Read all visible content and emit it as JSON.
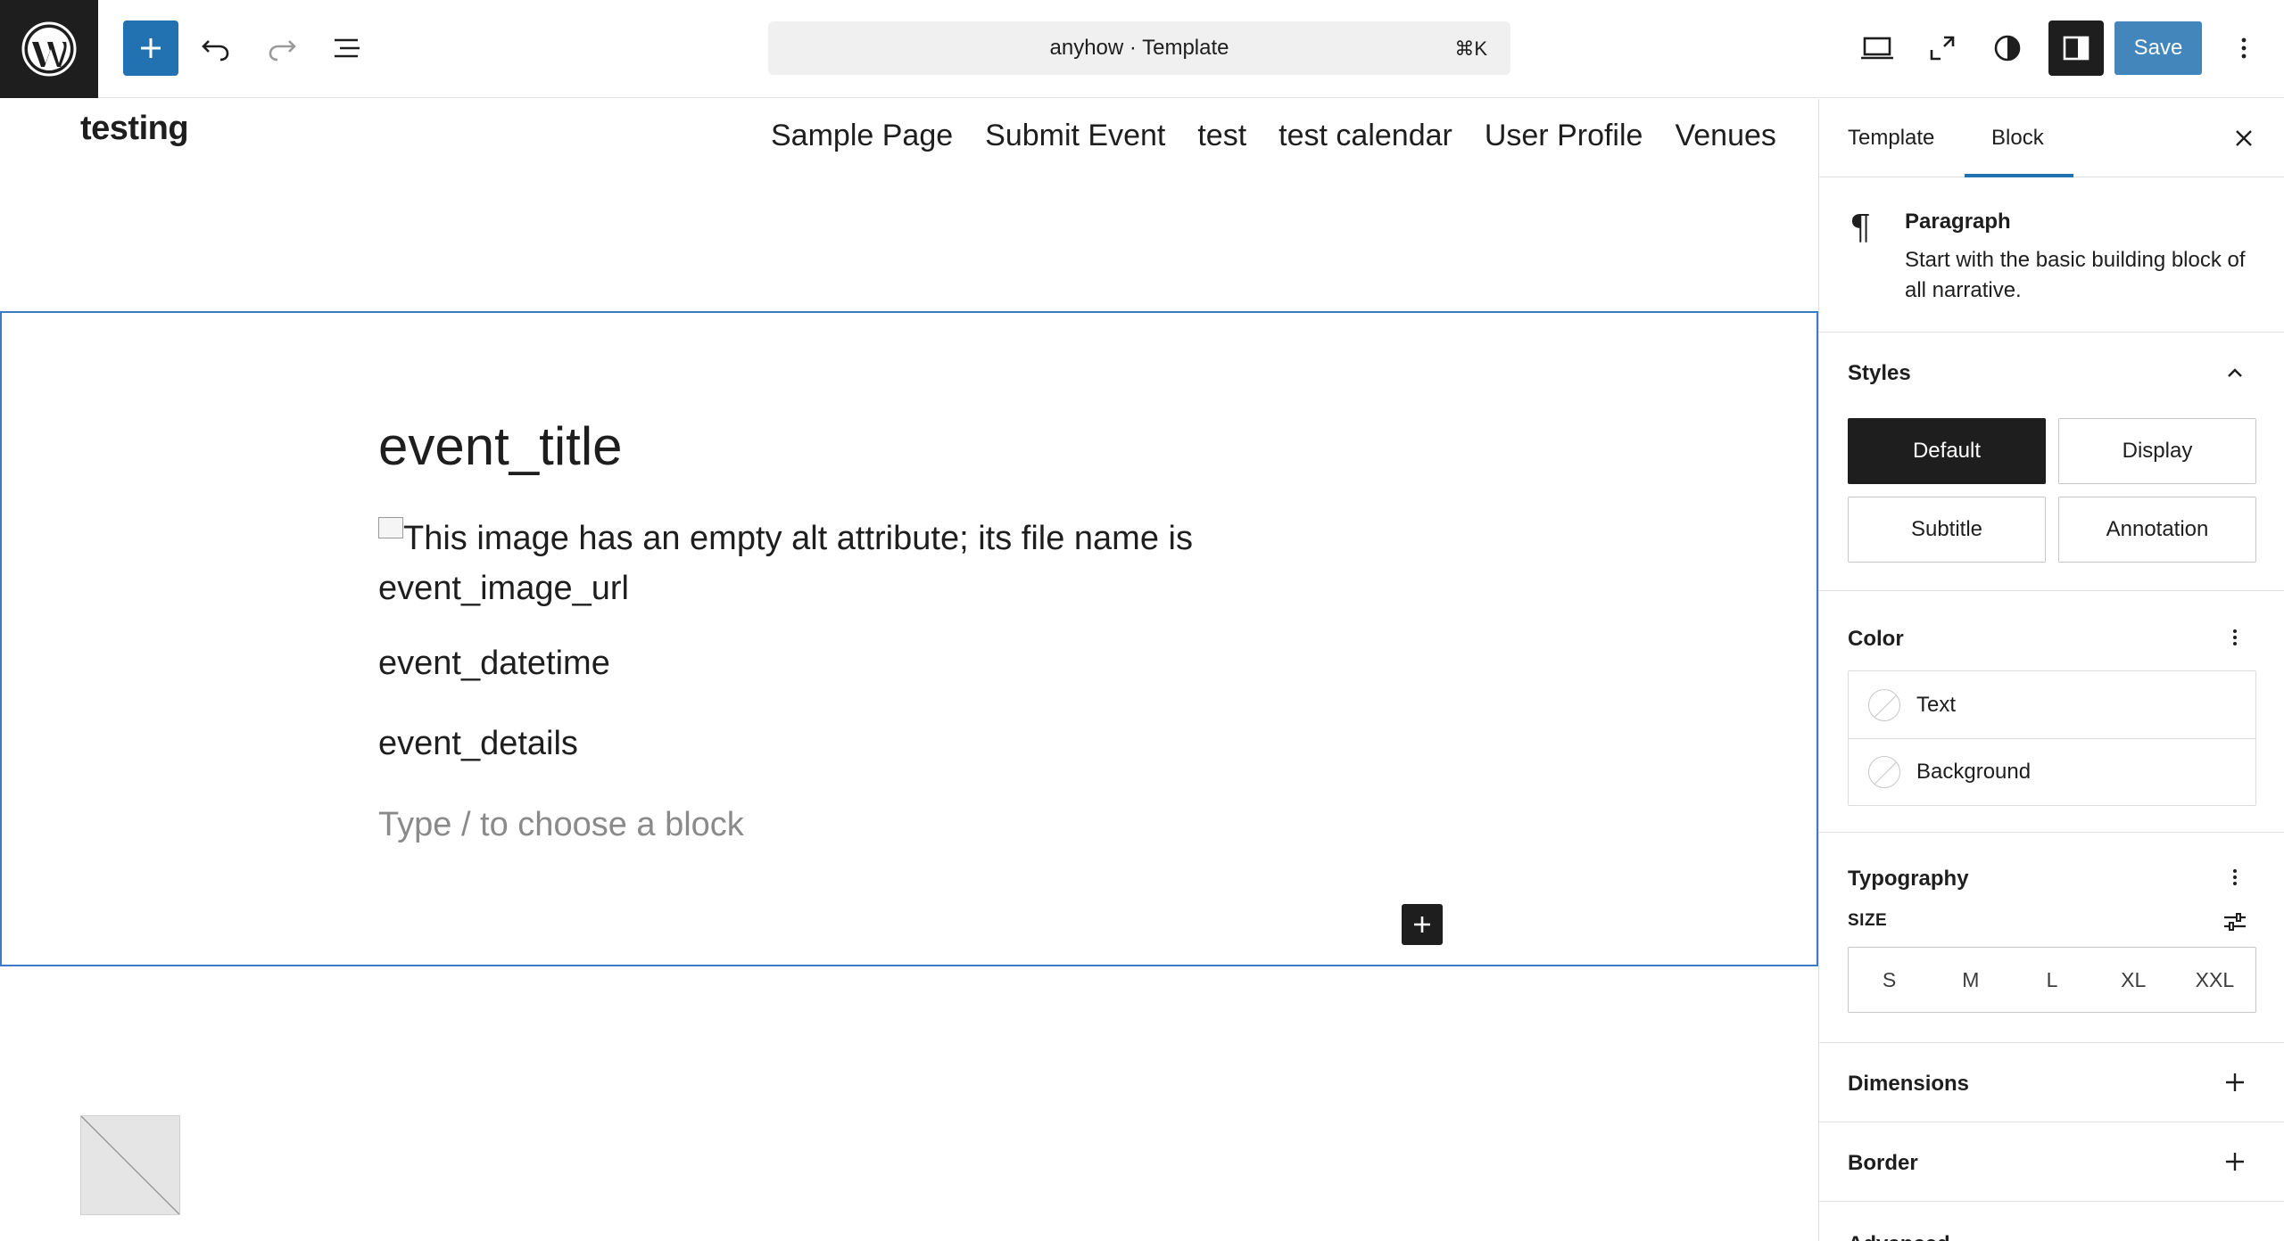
{
  "topbar": {
    "logo_icon": "wordpress-logo",
    "inserter_icon": "plus-icon",
    "undo_icon": "undo-icon",
    "redo_icon": "redo-icon",
    "listview_icon": "list-view-icon",
    "command_title": "anyhow · Template",
    "command_shortcut": "⌘K",
    "device_icon": "desktop-icon",
    "fullscreen_icon": "fullscreen-icon",
    "styles_icon": "contrast-icon",
    "settings_icon": "sidebar-icon",
    "save_label": "Save",
    "options_icon": "more-vertical-icon",
    "accent_color": "#2271b1"
  },
  "canvas": {
    "site_title": "testing",
    "nav": [
      "Sample Page",
      "Submit Event",
      "test",
      "test calendar",
      "User Profile",
      "Venues"
    ],
    "event_title": "event_title",
    "image_alt_text": "This image has an empty alt attribute; its file name is event_image_url",
    "event_datetime": "event_datetime",
    "event_details": "event_details",
    "placeholder": "Type / to choose a block"
  },
  "sidebar": {
    "tabs": [
      "Template",
      "Block"
    ],
    "active_tab": "Block",
    "block": {
      "icon": "paragraph-icon",
      "name": "Paragraph",
      "description": "Start with the basic building block of all narrative."
    },
    "styles": {
      "title": "Styles",
      "options": [
        "Default",
        "Display",
        "Subtitle",
        "Annotation"
      ],
      "active": "Default"
    },
    "color": {
      "title": "Color",
      "items": [
        "Text",
        "Background"
      ]
    },
    "typography": {
      "title": "Typography",
      "size_label": "SIZE",
      "sizes": [
        "S",
        "M",
        "L",
        "XL",
        "XXL"
      ]
    },
    "dimensions_title": "Dimensions",
    "border_title": "Border",
    "advanced_title": "Advanced"
  }
}
